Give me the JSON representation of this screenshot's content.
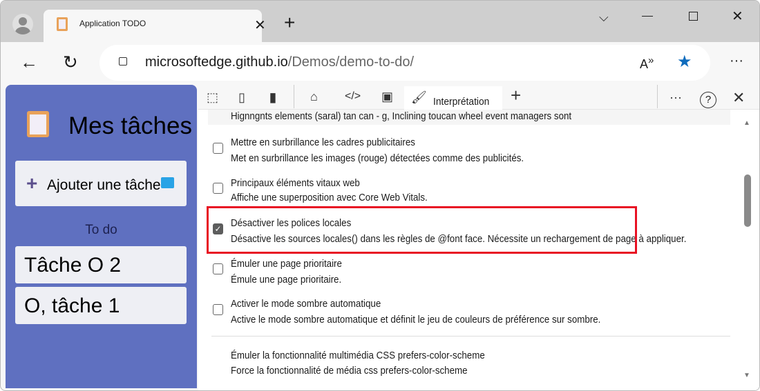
{
  "browser": {
    "tab_title": "Application TODO",
    "url_host": "microsoftedge.github.io",
    "url_path": "/Demos/demo-to-do/"
  },
  "app": {
    "title": "Mes tâches",
    "add_button": "Ajouter une tâche",
    "section": "To do",
    "tasks": [
      "Tâche O 2",
      "O, tâche 1"
    ]
  },
  "devtools": {
    "active_tab": "Interprétation",
    "partial_text": "Hignngnts elements (saral) tan can - g, Inclining toucan wheel event managers sont",
    "options": [
      {
        "title": "Mettre en surbrillance les cadres publicitaires",
        "desc": "Met en surbrillance les images (rouge) détectées comme des publicités.",
        "checked": false
      },
      {
        "title": "Principaux éléments vitaux web",
        "desc": "Affiche une superposition avec Core Web Vitals.",
        "checked": false
      },
      {
        "title": "Désactiver les polices locales",
        "desc": "Désactive les sources locales() dans les règles de @font face. Nécessite un rechargement de page à appliquer.",
        "checked": true
      },
      {
        "title": "Émuler une page prioritaire",
        "desc": "Émule une page prioritaire.",
        "checked": false
      },
      {
        "title": "Activer le mode sombre automatique",
        "desc": "Active le mode sombre automatique et définit le jeu de couleurs de préférence sur sombre.",
        "checked": false
      }
    ],
    "section": {
      "title": "Émuler la fonctionnalité multimédia CSS prefers-color-scheme",
      "desc": "Force la fonctionnalité de média css prefers-color-scheme"
    }
  },
  "colors": {
    "highlight": "#e81123",
    "accent": "#0f6cbd",
    "app_bg": "#5f70c0"
  }
}
